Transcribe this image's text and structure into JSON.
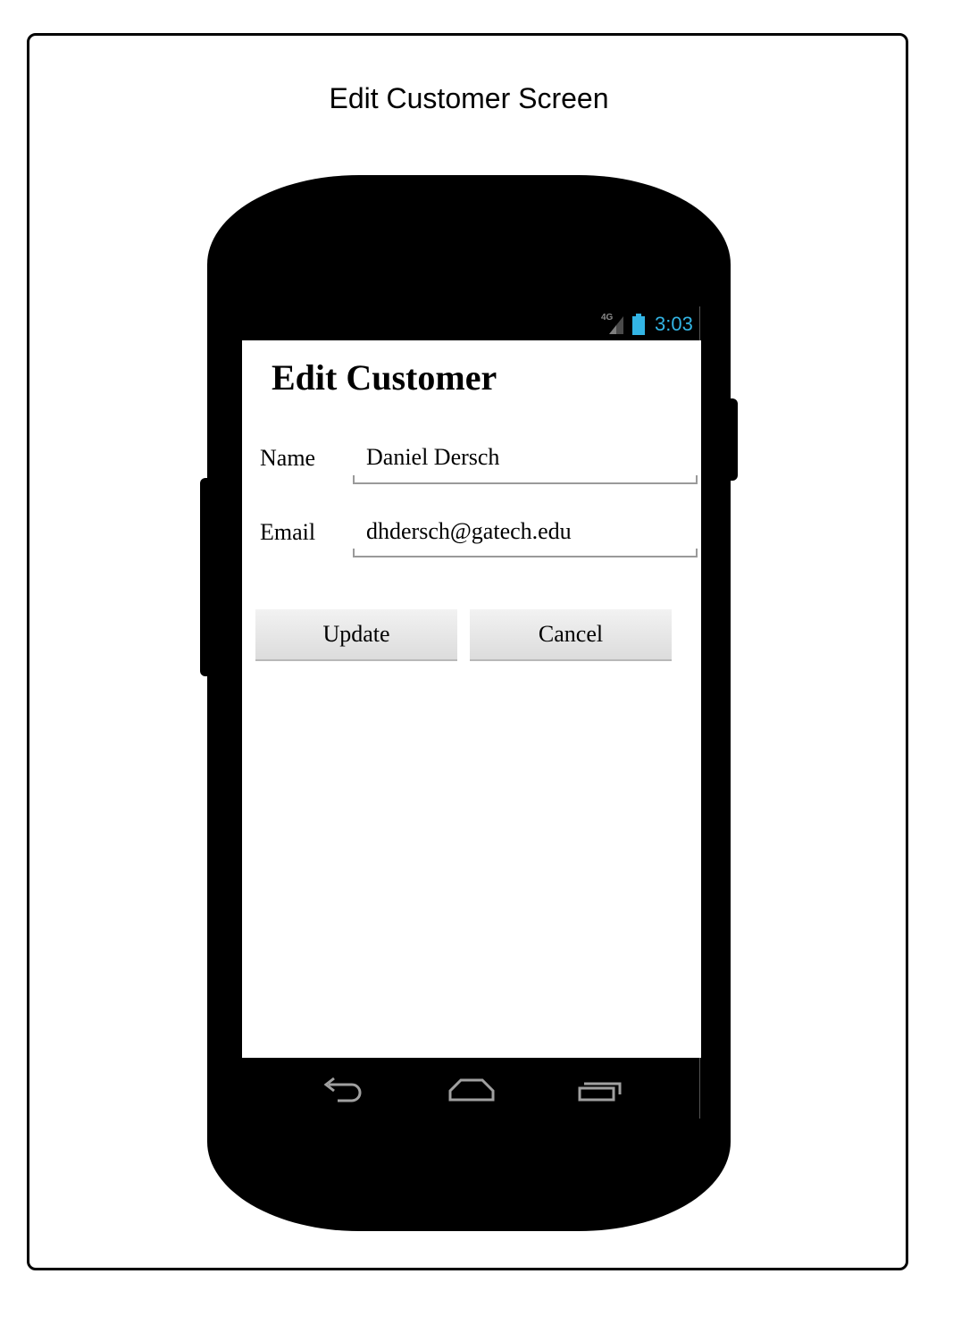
{
  "diagram": {
    "title": "Edit Customer Screen"
  },
  "status_bar": {
    "network": "4G",
    "time": "3:03",
    "time_color": "#33b5e5",
    "icons": [
      "signal-icon",
      "battery-icon"
    ]
  },
  "screen": {
    "title": "Edit Customer",
    "fields": [
      {
        "label": "Name",
        "value": "Daniel Dersch"
      },
      {
        "label": "Email",
        "value": "dhdersch@gatech.edu"
      }
    ],
    "buttons": {
      "update": "Update",
      "cancel": "Cancel"
    }
  },
  "nav_bar": {
    "icons": [
      "back-icon",
      "home-icon",
      "recent-apps-icon"
    ]
  }
}
